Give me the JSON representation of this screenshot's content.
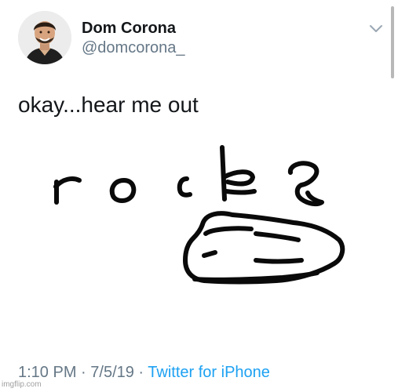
{
  "tweet": {
    "author": {
      "display_name": "Dom Corona",
      "handle": "@domcorona_",
      "avatar_icon": "profile-photo"
    },
    "menu_icon": "chevron-down-icon",
    "text": "okay...hear me out",
    "drawing": {
      "letters": "rock",
      "description_icon": "hand-drawn-rock-sketch"
    },
    "meta": {
      "time": "1:10 PM",
      "separator_1": " · ",
      "date": "7/5/19",
      "separator_2": " · ",
      "source": "Twitter for iPhone"
    }
  },
  "watermark": "imgflip.com",
  "colors": {
    "text_primary": "#14171a",
    "text_secondary": "#657786",
    "link_blue": "#1da1f2",
    "background": "#ffffff"
  }
}
